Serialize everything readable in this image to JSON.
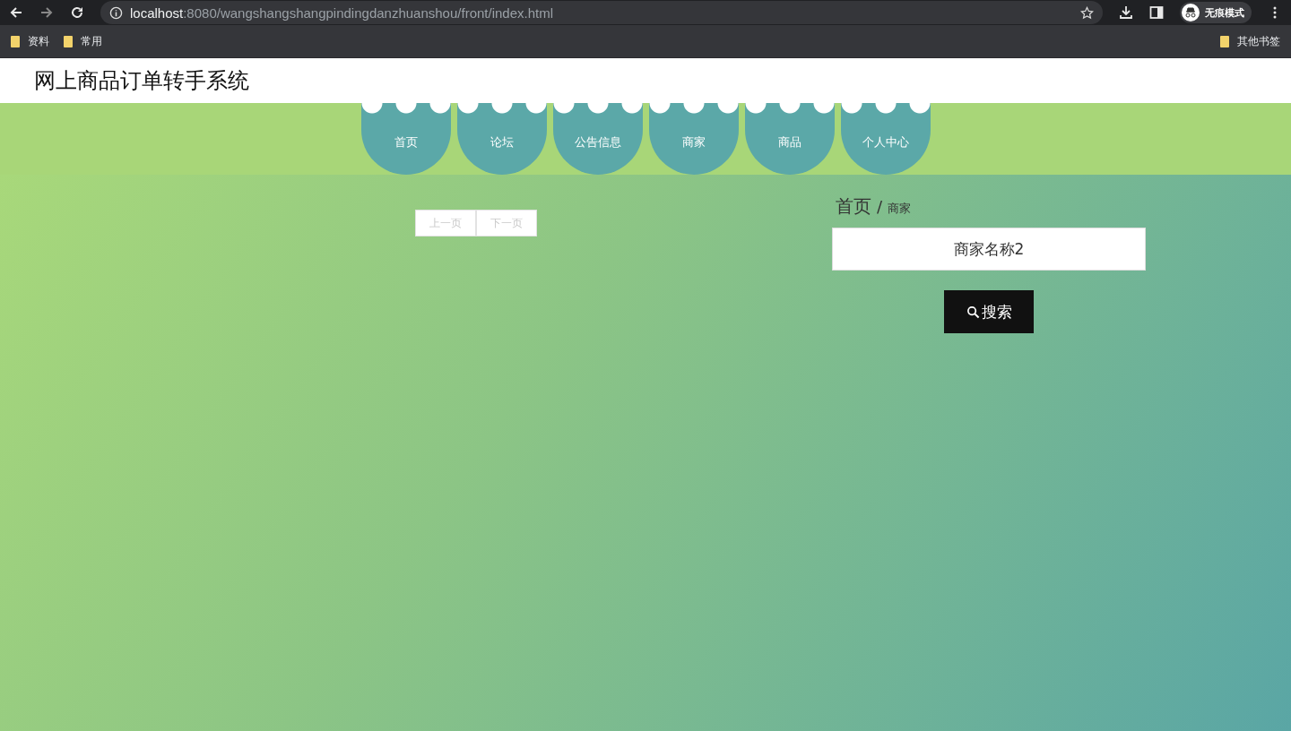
{
  "browser": {
    "url_host": "localhost",
    "url_rest": ":8080/wangshangshangpindingdanzhuanshou/front/index.html",
    "profile": "无痕模式",
    "bookmarks": [
      "资料",
      "常用"
    ],
    "other_bookmarks": "其他书签"
  },
  "site": {
    "title": "网上商品订单转手系统"
  },
  "nav": [
    {
      "label": "首页"
    },
    {
      "label": "论坛"
    },
    {
      "label": "公告信息"
    },
    {
      "label": "商家"
    },
    {
      "label": "商品"
    },
    {
      "label": "个人中心"
    }
  ],
  "pagination": [
    {
      "label": "上一页",
      "disabled": true
    },
    {
      "label": "下一页",
      "disabled": true
    }
  ],
  "breadcrumb": {
    "home": "首页",
    "separator": "/",
    "current": "商家"
  },
  "search": {
    "value": "商家名称2",
    "button": "搜索"
  }
}
